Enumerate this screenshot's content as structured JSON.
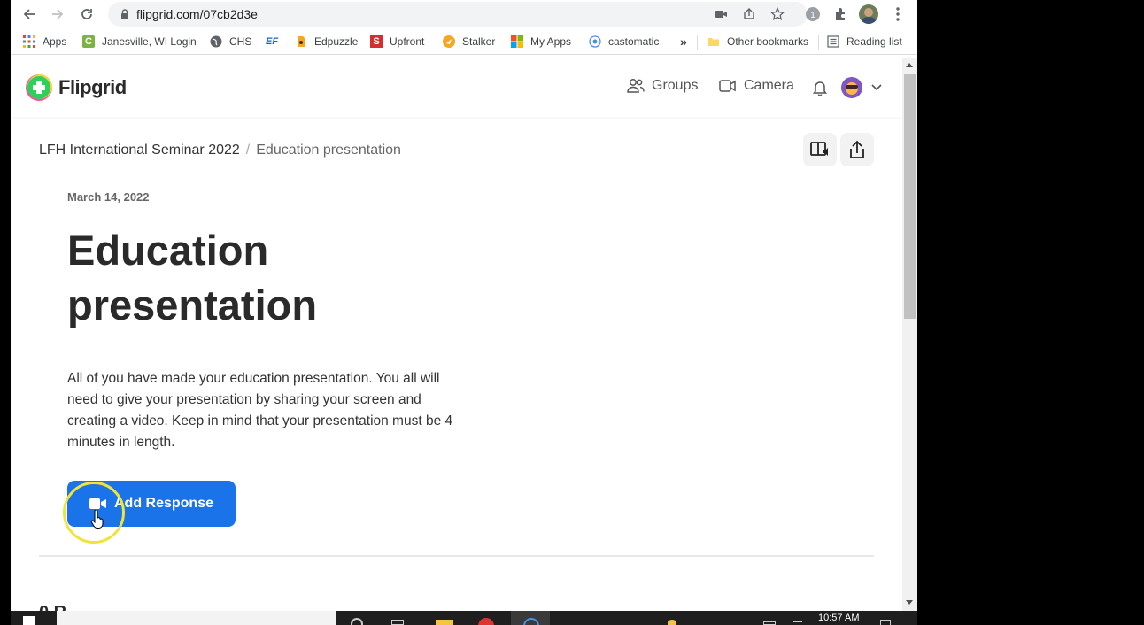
{
  "browser": {
    "url": "flipgrid.com/07cb2d3e"
  },
  "bookmarks": [
    {
      "label": "Apps",
      "icon": "apps-grid-icon"
    },
    {
      "label": "Janesville, WI Login",
      "icon": "c-green-icon"
    },
    {
      "label": "CHS",
      "icon": "globe-icon"
    },
    {
      "label": "",
      "icon": "ef-icon"
    },
    {
      "label": "Edpuzzle",
      "icon": "edpuzzle-icon"
    },
    {
      "label": "Upfront",
      "icon": "upfront-icon"
    },
    {
      "label": "Stalker",
      "icon": "stalker-icon"
    },
    {
      "label": "My Apps",
      "icon": "microsoft-icon"
    },
    {
      "label": "castomatic",
      "icon": "castomatic-icon"
    }
  ],
  "bookmarks_right": {
    "overflow": "»",
    "other": "Other bookmarks",
    "reading_list": "Reading list"
  },
  "header": {
    "logo_text": "Flipgrid",
    "groups": "Groups",
    "camera": "Camera"
  },
  "breadcrumb": {
    "parent": "LFH International Seminar 2022",
    "separator": "/",
    "current": "Education presentation"
  },
  "topic": {
    "date": "March 14, 2022",
    "title": "Education presentation",
    "description": "All of you have made your education presentation. You all will need to give your presentation by sharing your screen and creating a video. Keep in mind that your presentation must be 4 minutes in length.",
    "add_response": "Add Response",
    "responses_partial": "0 R"
  },
  "taskbar": {
    "time": "10:57 AM"
  },
  "colors": {
    "accent": "#1a73e8",
    "cursor_highlight": "#f0e33a"
  }
}
